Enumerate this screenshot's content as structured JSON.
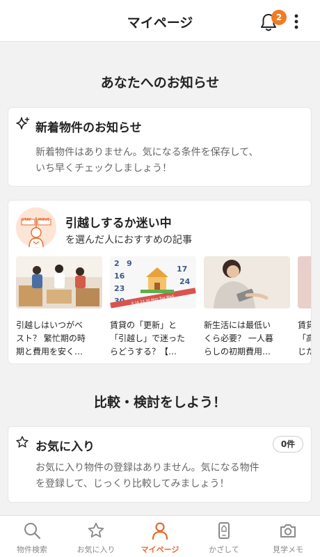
{
  "header": {
    "title": "マイページ",
    "notification_count": "2"
  },
  "notices": {
    "section_title": "あなたへのお知らせ",
    "new_listings": {
      "title": "新着物件のお知らせ",
      "desc_line1": "新着物件はありません。気になる条件を保存して、",
      "desc_line2": "いち早くチェックしましょう！"
    },
    "moving": {
      "title": "引越しするか迷い中",
      "subtitle": "を選んだ人におすすめの記事",
      "illustration_sign_left": "STAY",
      "illustration_sign_right": "MOVE",
      "articles": [
        {
          "line1": "引越しはいつがベ",
          "line2": "スト？ 繁忙期の時",
          "line3": "期と費用を安く…"
        },
        {
          "line1": "賃貸の「更新」と",
          "line2": "「引越し」で迷った",
          "line3": "らどうする？【…"
        },
        {
          "line1": "新生活には最低い",
          "line2": "くら必要？ 一人暮",
          "line3": "らしの初期費用…"
        },
        {
          "line1": "賃貸",
          "line2": "「高",
          "line3": "じた"
        }
      ],
      "calendar_numbers": "9 16 23 30 Mon Tue Wed"
    }
  },
  "compare": {
    "section_title": "比較・検討をしよう！",
    "favorites": {
      "title": "お気に入り",
      "count": "0件",
      "desc_line1": "お気に入り物件の登録はありません。気になる物件",
      "desc_line2": "を登録して、じっくり比較してみましょう！"
    }
  },
  "tabbar": {
    "tabs": [
      {
        "label": "物件検索"
      },
      {
        "label": "お気に入り"
      },
      {
        "label": "マイページ"
      },
      {
        "label": "かざして"
      },
      {
        "label": "見学メモ"
      }
    ]
  },
  "colors": {
    "accent": "#f07b25",
    "active_tab": "#e8692a"
  }
}
